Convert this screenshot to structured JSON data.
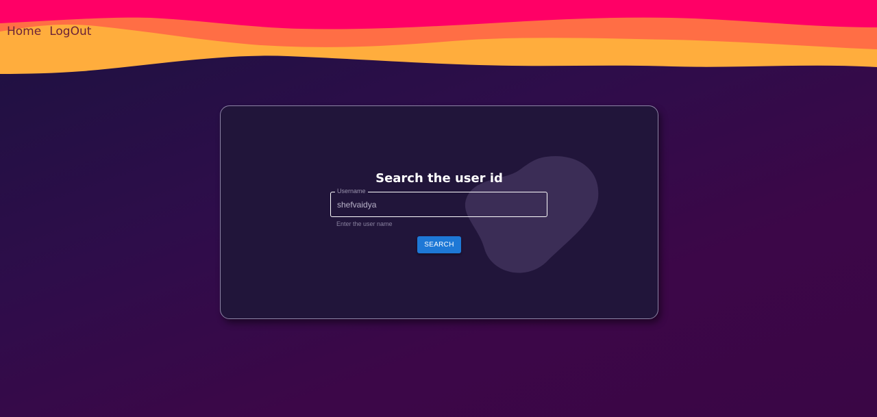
{
  "nav": {
    "home_label": "Home",
    "logout_label": "LogOut"
  },
  "card": {
    "title": "Search the user id",
    "field": {
      "label": "Username",
      "value": "shefvaidya",
      "helper": "Enter the user name"
    },
    "search_label": "SEARCH"
  },
  "colors": {
    "wave_top": "#ff0066",
    "wave_middle": "#ff6e45",
    "wave_bottom": "#ffad3d",
    "background": "#2e0d4a",
    "card_background": "#21153a",
    "button": "#1e78d6"
  }
}
